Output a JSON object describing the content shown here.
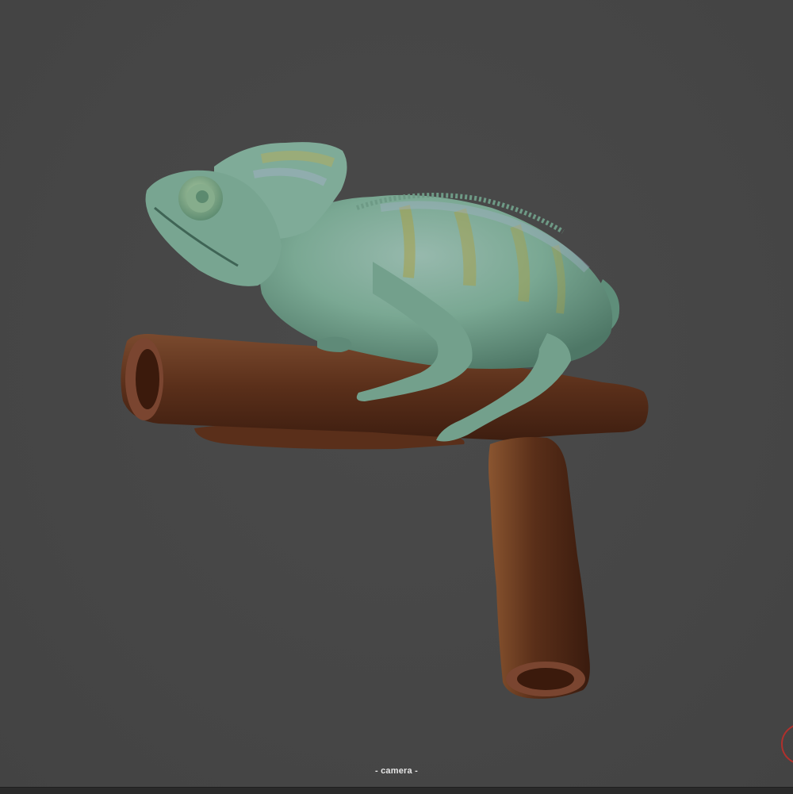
{
  "viewport": {
    "camera_label": "- camera -",
    "background_color": "#474747"
  },
  "model": {
    "name_icon": "chameleon-on-branch-sculpt",
    "body_color": "#79a892",
    "branch_color": "#6a3a22"
  },
  "gizmo": {
    "icon": "navigation-gizmo-icon",
    "color": "#b0302c"
  }
}
